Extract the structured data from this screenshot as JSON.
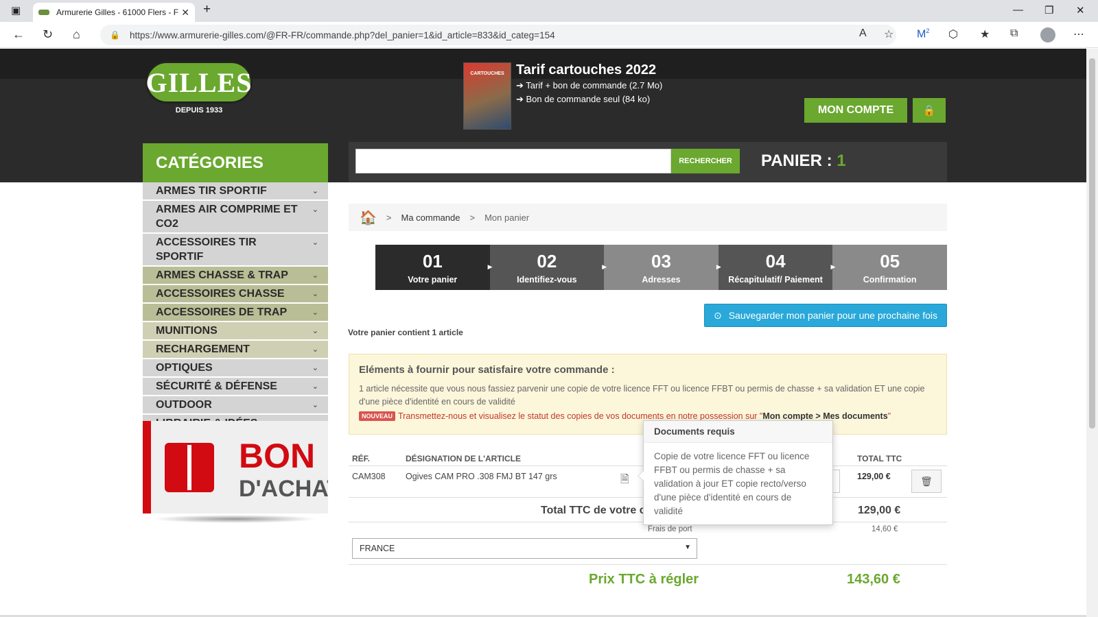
{
  "browser": {
    "tab_title": "Armurerie Gilles - 61000 Flers - F",
    "url": "https://www.armurerie-gilles.com/@FR-FR/commande.php?del_panier=1&id_article=833&id_categ=154",
    "ext_badge": "2"
  },
  "header": {
    "logo_text": "GILLES",
    "logo_since": "DEPUIS 1933",
    "catalog_cover_text": "CARTOUCHES",
    "tarif_title": "Tarif cartouches 2022",
    "tarif_link_1": "➔ Tarif + bon de commande (2.7 Mo)",
    "tarif_link_2": "➔ Bon de commande seul (84 ko)",
    "account_label": "MON COMPTE",
    "search_label": "RECHERCHER",
    "search_placeholder": "",
    "panier_label": "PANIER : ",
    "panier_count": "1"
  },
  "categories": {
    "title": "CATÉGORIES",
    "items": [
      {
        "label": "ARMES TIR SPORTIF"
      },
      {
        "label": "ARMES AIR COMPRIME ET CO2"
      },
      {
        "label": "ACCESSOIRES TIR SPORTIF"
      },
      {
        "label": "ARMES CHASSE & TRAP"
      },
      {
        "label": "ACCESSOIRES CHASSE"
      },
      {
        "label": "ACCESSOIRES DE TRAP"
      },
      {
        "label": "MUNITIONS"
      },
      {
        "label": "RECHARGEMENT"
      },
      {
        "label": "OPTIQUES"
      },
      {
        "label": "SÉCURITÉ & DÉFENSE"
      },
      {
        "label": "OUTDOOR"
      },
      {
        "label": "LIBRAIRIE & IDÉES CADEAUX"
      }
    ]
  },
  "promo": {
    "line1": "BON",
    "line2": "D'ACHAT"
  },
  "breadcrumb": {
    "item1": "Ma commande",
    "item2": "Mon panier",
    "sep": ">"
  },
  "steps": [
    {
      "num": "01",
      "label": "Votre panier"
    },
    {
      "num": "02",
      "label": "Identifiez-vous"
    },
    {
      "num": "03",
      "label": "Adresses"
    },
    {
      "num": "04",
      "label": "Récapitulatif/ Paiement"
    },
    {
      "num": "05",
      "label": "Confirmation"
    }
  ],
  "cart": {
    "save_label": "Sauvegarder mon panier pour une prochaine fois",
    "count_text": "Votre panier contient 1 article",
    "alert_title": "Eléments à fournir pour satisfaire votre commande :",
    "alert_text": "1 article nécessite que vous nous fassiez parvenir une copie de votre licence FFT ou licence FFBT ou permis de chasse + sa validation ET une copie d'une pièce d'identité en cours de validité",
    "new_badge": "NOUVEAU",
    "new_text": "Transmettez-nous et visualisez le statut des copies de vos documents en notre possession sur \"",
    "new_link": "Mon compte > Mes documents",
    "new_end": "\"",
    "col_ref": "RÉF.",
    "col_designation": "DÉSIGNATION DE L'ARTICLE",
    "col_total": "TOTAL TTC",
    "item_ref": "CAM308",
    "item_name": "Ogives CAM PRO .308 FMJ BT 147 grs",
    "item_total": "129,00 €",
    "total_label": "Total TTC de votre c",
    "total_value": "129,00 €",
    "frais_label": "Frais de port",
    "frais_value": "14,60 €",
    "country": "FRANCE",
    "pay_label": "Prix TTC à régler",
    "pay_value": "143,60 €"
  },
  "popover": {
    "title": "Documents requis",
    "body": "Copie de votre licence FFT ou licence FFBT ou permis de chasse + sa validation à jour ET copie recto/verso d'une pièce d'identité en cours de validité"
  }
}
